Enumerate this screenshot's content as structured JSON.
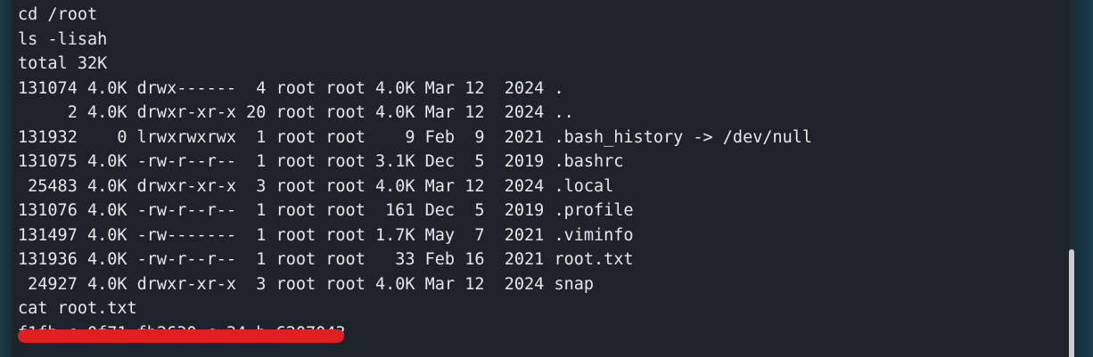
{
  "terminal": {
    "lines": [
      "cd /root",
      "ls -lisah",
      "total 32K",
      "131074 4.0K drwx------  4 root root 4.0K Mar 12  2024 .",
      "     2 4.0K drwxr-xr-x 20 root root 4.0K Mar 12  2024 ..",
      "131932    0 lrwxrwxrwx  1 root root    9 Feb  9  2021 .bash_history -> /dev/null",
      "131075 4.0K -rw-r--r--  1 root root 3.1K Dec  5  2019 .bashrc",
      " 25483 4.0K drwxr-xr-x  3 root root 4.0K Mar 12  2024 .local",
      "131076 4.0K -rw-r--r--  1 root root  161 Dec  5  2019 .profile",
      "131497 4.0K -rw-------  1 root root 1.7K May  7  2021 .viminfo",
      "131936 4.0K -rw-r--r--  1 root root   33 Feb 16  2021 root.txt",
      " 24927 4.0K drwxr-xr-x  3 root root 4.0K Mar 12  2024 snap",
      "cat root.txt"
    ],
    "redacted_line": "f1fb c 0f71 fb2630 c 34 b 6207043"
  },
  "colors": {
    "background": "#1e232b",
    "text": "#e6e8ea",
    "redaction": "#e0201e",
    "scrollbar_thumb": "#c9ccd0"
  }
}
